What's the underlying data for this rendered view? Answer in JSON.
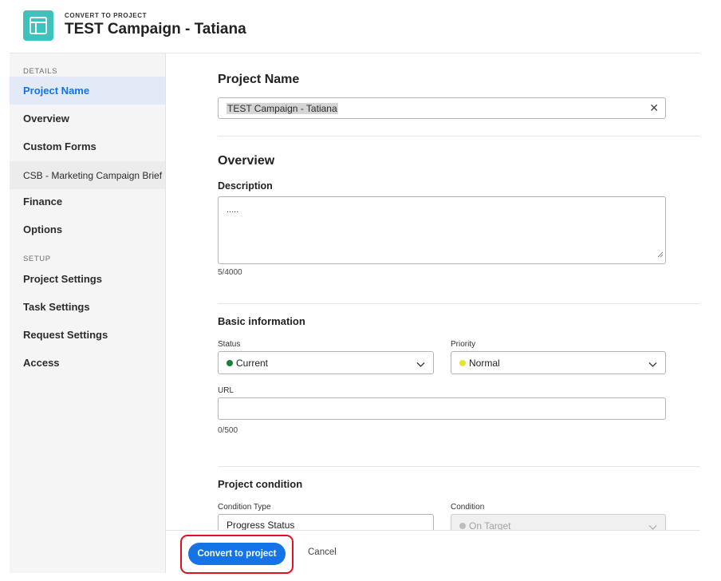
{
  "header": {
    "eyebrow": "CONVERT TO PROJECT",
    "title": "TEST Campaign - Tatiana",
    "icon": "project-template-icon",
    "icon_color": "#3ec2bd"
  },
  "sidebar": {
    "details_label": "DETAILS",
    "setup_label": "SETUP",
    "details_items": [
      {
        "label": "Project Name",
        "active": true
      },
      {
        "label": "Overview"
      },
      {
        "label": "Custom Forms"
      },
      {
        "label": "CSB - Marketing Campaign Brief"
      },
      {
        "label": "Finance"
      },
      {
        "label": "Options"
      }
    ],
    "setup_items": [
      {
        "label": "Project Settings"
      },
      {
        "label": "Task Settings"
      },
      {
        "label": "Request Settings"
      },
      {
        "label": "Access"
      }
    ]
  },
  "main": {
    "project_name": {
      "heading": "Project Name",
      "value": "TEST Campaign - Tatiana"
    },
    "overview": {
      "heading": "Overview",
      "description_label": "Description",
      "description_value": ".....",
      "description_counter": "5/4000"
    },
    "basic_information": {
      "heading": "Basic information",
      "status_label": "Status",
      "status_value": "Current",
      "status_color": "#1a7f37",
      "priority_label": "Priority",
      "priority_value": "Normal",
      "priority_color": "#e6e62e",
      "url_label": "URL",
      "url_value": "",
      "url_counter": "0/500"
    },
    "project_condition": {
      "heading": "Project condition",
      "condition_type_label": "Condition Type",
      "condition_type_value": "Progress Status",
      "condition_label": "Condition",
      "condition_value": "On Target"
    }
  },
  "footer": {
    "primary_label": "Convert to project",
    "cancel_label": "Cancel",
    "accent": "#1473e6",
    "highlight_color": "#e0101d"
  }
}
